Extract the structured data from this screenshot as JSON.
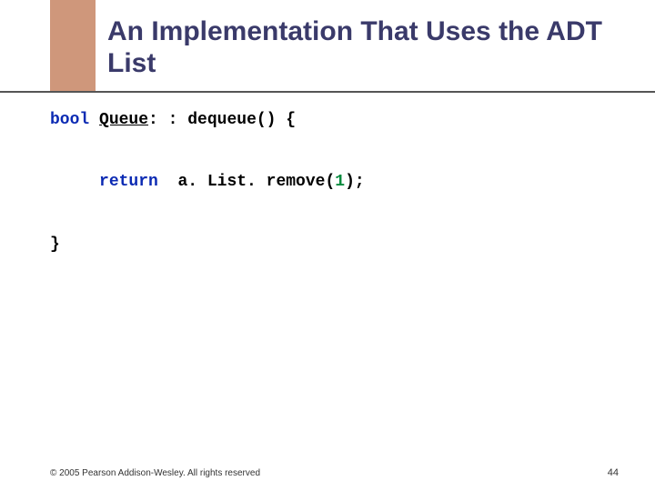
{
  "title": "An Implementation That Uses the ADT List",
  "code": {
    "kw_bool": "bool",
    "class_name": "Queue",
    "sig_tail": ": : dequeue() {",
    "kw_return": "return",
    "call_head": "a. List. remove(",
    "num": "1",
    "call_tail": ");",
    "close": "}"
  },
  "footer": "© 2005 Pearson Addison-Wesley. All rights reserved",
  "page": "44"
}
